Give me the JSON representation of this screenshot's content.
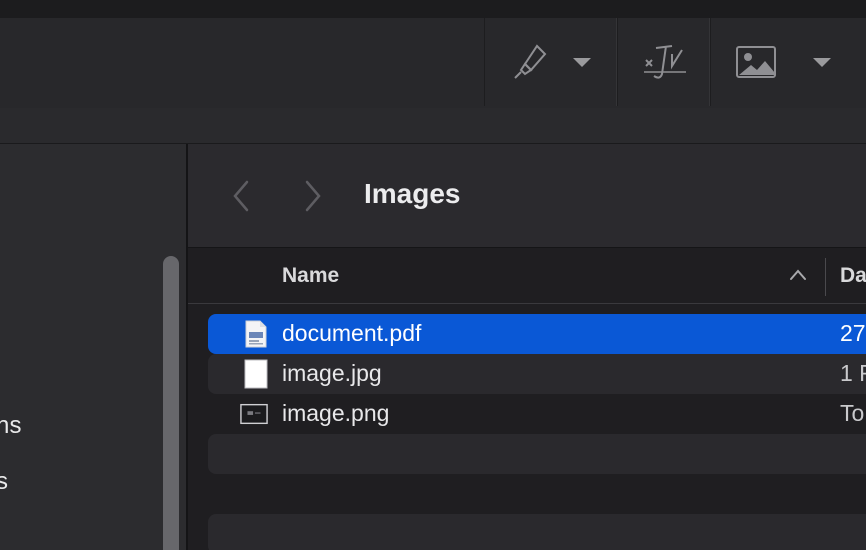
{
  "toolbar": {
    "tools": [
      {
        "icon": "highlighter-icon",
        "has_menu": true
      },
      {
        "icon": "signature-icon",
        "has_menu": false
      },
      {
        "icon": "image-icon",
        "has_menu": true
      }
    ]
  },
  "sidebar": {
    "items": [
      {
        "label": "ns"
      },
      {
        "label": "s"
      }
    ]
  },
  "browser": {
    "title": "Images",
    "columns": {
      "name": "Name",
      "date": "Da",
      "sort": "ascending"
    },
    "files": [
      {
        "name": "document.pdf",
        "date": "27",
        "icon": "pdf-file-icon",
        "selected": true
      },
      {
        "name": "image.jpg",
        "date": "1 F",
        "icon": "jpg-file-icon",
        "selected": false
      },
      {
        "name": "image.png",
        "date": "To",
        "icon": "png-file-icon",
        "selected": false
      }
    ]
  },
  "colors": {
    "selection": "#0a58d6",
    "window_bg": "#1f1e21",
    "sidebar_bg": "#2c2c2f"
  }
}
